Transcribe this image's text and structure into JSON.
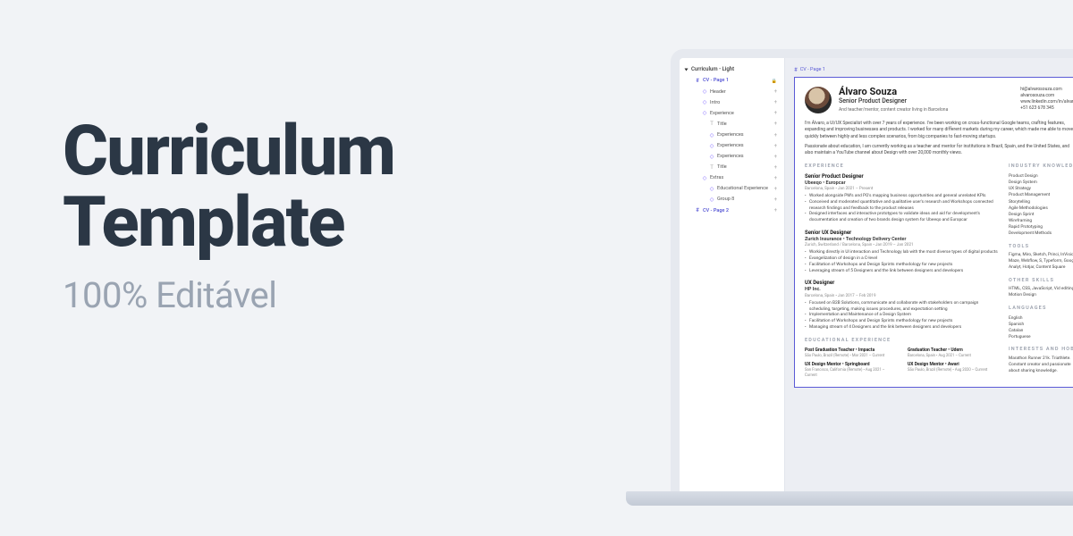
{
  "hero": {
    "title_l1": "Curriculum",
    "title_l2": "Template",
    "subtitle": "100% Editável"
  },
  "layers": {
    "root": "Curriculum - Light",
    "rows": [
      {
        "kind": "frame",
        "depth": 1,
        "label": "CV - Page 1",
        "trail": "lock"
      },
      {
        "kind": "comp",
        "depth": 2,
        "label": "Header",
        "trail": "plus"
      },
      {
        "kind": "comp",
        "depth": 2,
        "label": "Intro",
        "trail": "plus"
      },
      {
        "kind": "comp",
        "depth": 2,
        "label": "Experience",
        "trail": "plus"
      },
      {
        "kind": "txt",
        "depth": 3,
        "label": "Title",
        "trail": "plus"
      },
      {
        "kind": "comp",
        "depth": 3,
        "label": "Experiences",
        "trail": "plus"
      },
      {
        "kind": "comp",
        "depth": 3,
        "label": "Experiences",
        "trail": "plus"
      },
      {
        "kind": "comp",
        "depth": 3,
        "label": "Experiences",
        "trail": "plus"
      },
      {
        "kind": "txt",
        "depth": 3,
        "label": "Title",
        "trail": "plus"
      },
      {
        "kind": "comp",
        "depth": 2,
        "label": "Extras",
        "trail": "plus"
      },
      {
        "kind": "comp",
        "depth": 3,
        "label": "Educational Experience",
        "trail": "plus"
      },
      {
        "kind": "comp",
        "depth": 3,
        "label": "Group 8",
        "trail": "plus"
      },
      {
        "kind": "frame",
        "depth": 1,
        "label": "CV - Page 2",
        "trail": "plus"
      }
    ]
  },
  "canvas_tab": "CV - Page 1",
  "resume": {
    "name": "Álvaro Souza",
    "role": "Senior Product Designer",
    "tagline": "And teacher/mentor, content creator living in Barcelona",
    "contact": [
      "hi@alvarosouza.com",
      "alvarosouza.com",
      "www.linkedin.com/in/alvaros",
      "+51 623 678 345"
    ],
    "intro": [
      "I'm Álvaro, a UI/UX Specialist with over 7 years of experience. I've been working on cross-functional Google teams, crafting features, expanding and improving businesses and products. I worked for many different markets during my career, which made me able to move quickly between highly and less complex scenarios, from big companies to fast-moving startups.",
      "Passionate about education, I am currently working as a teacher and mentor for institutions in Brazil, Spain, and the United States, and also maintain a YouTube channel about Design with over 20,000 monthly views."
    ],
    "exp_heading": "EXPERIENCE",
    "jobs": [
      {
        "title": "Senior Product Designer",
        "company": "Ubeeqo • Europcar",
        "meta": "Barcelona, Spain • Jan 2021 – Present",
        "bullets": [
          "Worked alongside PM's and PO's mapping business opportunities and general unrelated KPIs",
          "Conceived and moderated quantitative and qualitative user's research and Workshops connected research findings and feedback to the product releases",
          "Designed interfaces and interactive prototypes to validate ideas and aid for development's documentation and creation of two brands design system for Ubeeqo and Europcar"
        ]
      },
      {
        "title": "Senior UX Designer",
        "company": "Zurich Insurance • Technology Delivery Center",
        "meta": "Zurich, Switzerland / Barcelona, Spain • Jan 2019 – Jan 2021",
        "bullets": [
          "Working directly in UI interaction and Technology lab with the most diverse types of digital products",
          "Evangelization of design in a C-level",
          "Facilitation of Workshops and Design Sprints methodology for new projects",
          "Leveraging stream of 5 Designers and the link between designers and developers"
        ]
      },
      {
        "title": "UX Designer",
        "company": "HP Inc.",
        "meta": "Barcelona, Spain • Jan 2017 – Feb 2019",
        "bullets": [
          "Focused on B2B Solutions, communicate and collaborate with stakeholders on campaign scheduling, targeting, making issues procedures, and expectation setting",
          "Implementation and Maintenance of a Design System",
          "Facilitation of Workshops and Design Sprints methodology for new projects",
          "Managing stream of 4 Designers and the link between designers and developers"
        ]
      }
    ],
    "edu_heading": "EDUCATIONAL EXPERIENCE",
    "edu": [
      [
        {
          "title": "Post Graduation Teacher • Impacta",
          "meta": "São Paulo, Brazil (Remote) • Mar 2021 – Current"
        },
        {
          "title": "UX Design Mentor • Springboard",
          "meta": "San Francisco, California (Remote) • Aug 2021 – Current"
        }
      ],
      [
        {
          "title": "Graduation Teacher • Udern",
          "meta": "Barcelona, Spain • Aug 2021 – Current"
        },
        {
          "title": "UX Design Mentor • Awari",
          "meta": "São Paulo, Brazil (Remote) • Aug 2020 – Current"
        }
      ]
    ],
    "side": [
      {
        "h": "INDUSTRY KNOWLED",
        "items": [
          "Product Design",
          "Design System",
          "UX Strategy",
          "Product Management",
          "Storytelling",
          "Agile Methodologies",
          "Design Sprint",
          "Wireframing",
          "Rapid Prototyping",
          "Development Methods"
        ]
      },
      {
        "h": "TOOLS",
        "text": "Figma, Miro, Sketch, Princi, InVision, Maze, Webflow, S, Typeform, Google Analyt, Hotjar, Content Square"
      },
      {
        "h": "OTHER SKILLS",
        "text": "HTML, CSS, JavaScript, Vid editing, Motion Design"
      },
      {
        "h": "LANGUAGES",
        "items": [
          "English",
          "Spanish",
          "Catalan",
          "Portuguese"
        ]
      },
      {
        "h": "INTERESTS AND HOB",
        "text": "Marathon Runner 21k. Triathlete. Constant creator and passionate about sharing knowledge."
      }
    ]
  }
}
